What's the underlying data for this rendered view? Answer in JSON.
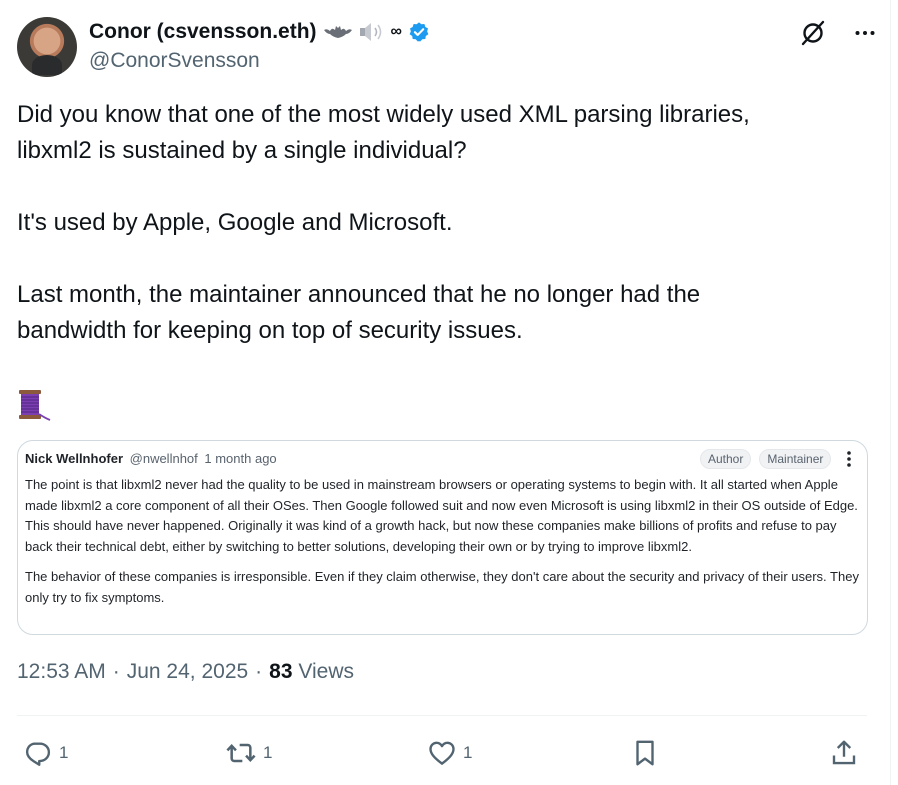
{
  "author": {
    "display_name": "Conor (csvensson.eth)",
    "emoji_suffix": "∞",
    "handle": "@ConorSvensson"
  },
  "tweet": {
    "text": "Did you know that one of the most widely used XML parsing libraries,\nlibxml2 is sustained by a single individual?\n\nIt's used by Apple, Google and Microsoft.\n\nLast month, the maintainer announced that he no longer had the\nbandwidth for keeping on top of security issues."
  },
  "embedded_comment": {
    "author": "Nick Wellnhofer",
    "handle": "@nwellnhof",
    "time": "1 month ago",
    "badges": [
      "Author",
      "Maintainer"
    ],
    "paragraphs": [
      "The point is that libxml2 never had the quality to be used in mainstream browsers or operating systems to begin with. It all started when Apple made libxml2 a core component of all their OSes. Then Google followed suit and now even Microsoft is using libxml2 in their OS outside of Edge. This should have never happened. Originally it was kind of a growth hack, but now these companies make billions of profits and refuse to pay back their technical debt, either by switching to better solutions, developing their own or by trying to improve libxml2.",
      "The behavior of these companies is irresponsible. Even if they claim otherwise, they don't care about the security and privacy of their users. They only try to fix symptoms."
    ]
  },
  "meta": {
    "time": "12:53 AM",
    "date": "Jun 24, 2025",
    "separator": "·",
    "views_count": "83",
    "views_label": "Views"
  },
  "actions": {
    "replies": "1",
    "reposts": "1",
    "likes": "1"
  },
  "icons": [
    "avatar",
    "bat-emoji",
    "speaker-emoji",
    "verified-badge-icon",
    "grok-icon",
    "more-icon",
    "spool-of-thread-emoji",
    "reply-icon",
    "repost-icon",
    "like-icon",
    "bookmark-icon",
    "share-icon"
  ],
  "colors": {
    "accent": "#1d9bf0",
    "text": "#0f1419",
    "secondary": "#536471",
    "border": "#cfd9de"
  }
}
